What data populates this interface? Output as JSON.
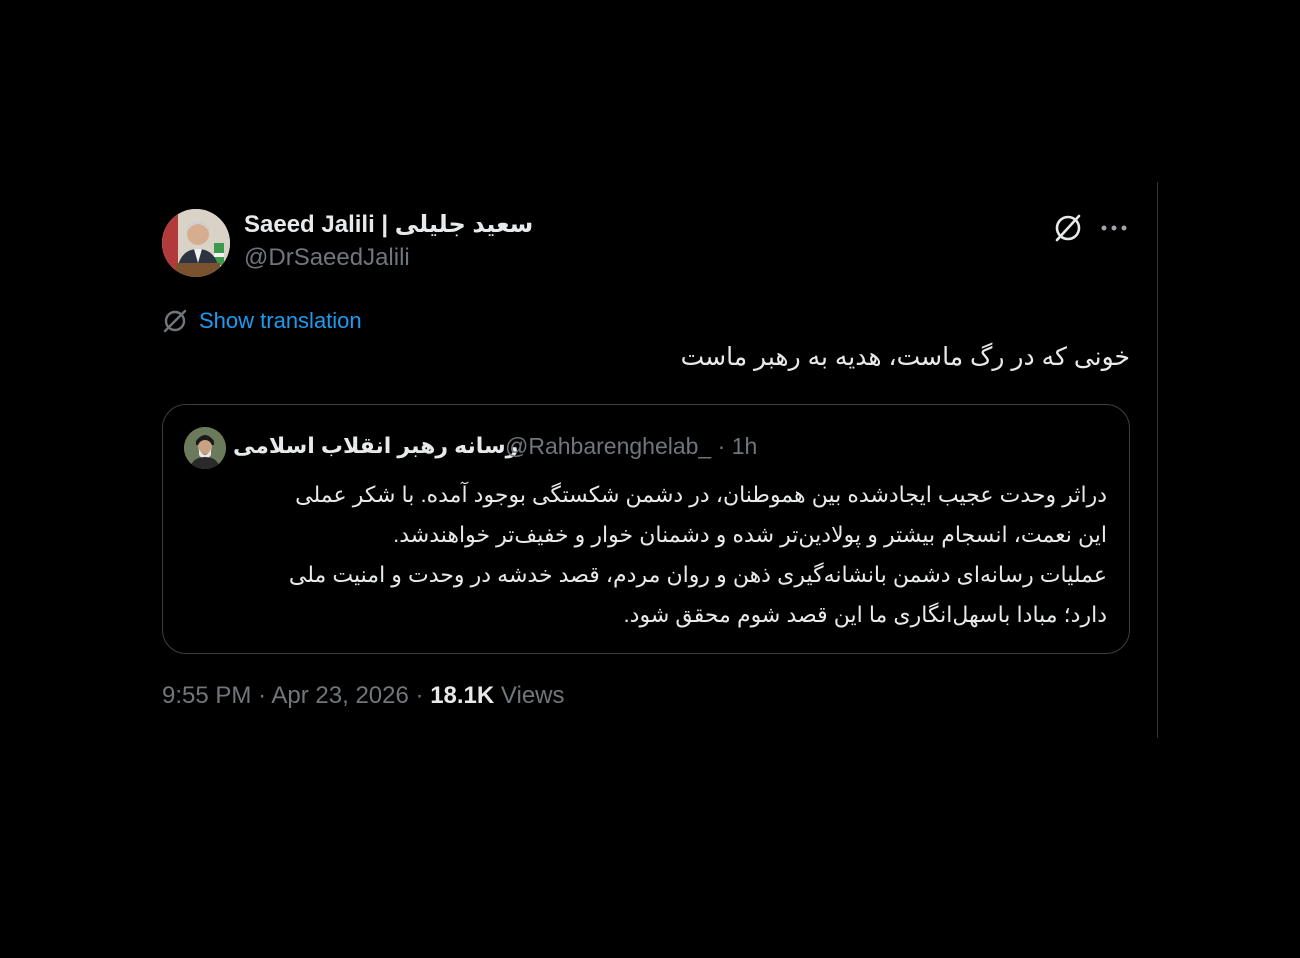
{
  "author": {
    "name": "Saeed Jalili | سعید جلیلی",
    "handle": "@DrSaeedJalili"
  },
  "actions": {
    "grok_icon": "grok-icon",
    "more_icon": "more-icon"
  },
  "translation": {
    "label": "Show translation",
    "icon": "translate-icon"
  },
  "tweet": {
    "text": "خونی که در رگ ماست، هدیه به رهبر ماست"
  },
  "quote": {
    "name": "رسانه رهبر انقلاب اسلامی",
    "handle": "@Rahbarenghelab_",
    "separator": "·",
    "time": "1h",
    "lines": [
      "دراثر وحدت عجیب ایجادشده بین هموطنان، در دشمن شکستگی بوجود آمده. با شکر عملی",
      "این نعمت، انسجام بیشتر و پولادین‌تر شده و دشمنان خوار و خفیف‌تر خواهندشد.",
      "عملیات رسانه‌ای دشمن بانشانه‌گیری ذهن و روان مردم، قصد خدشه در وحدت و امنیت ملی",
      "دارد؛ مبادا باسهل‌انگاری ما این قصد شوم محقق شود."
    ]
  },
  "meta": {
    "time": "9:55 PM",
    "date": "Apr 23, 2026",
    "sep": "·",
    "views_count": "18.1K",
    "views_label": "Views"
  },
  "colors": {
    "background": "#000000",
    "text": "#e7e9ea",
    "secondary": "#71767b",
    "link": "#1d9bf0",
    "border": "#3a3f44"
  }
}
